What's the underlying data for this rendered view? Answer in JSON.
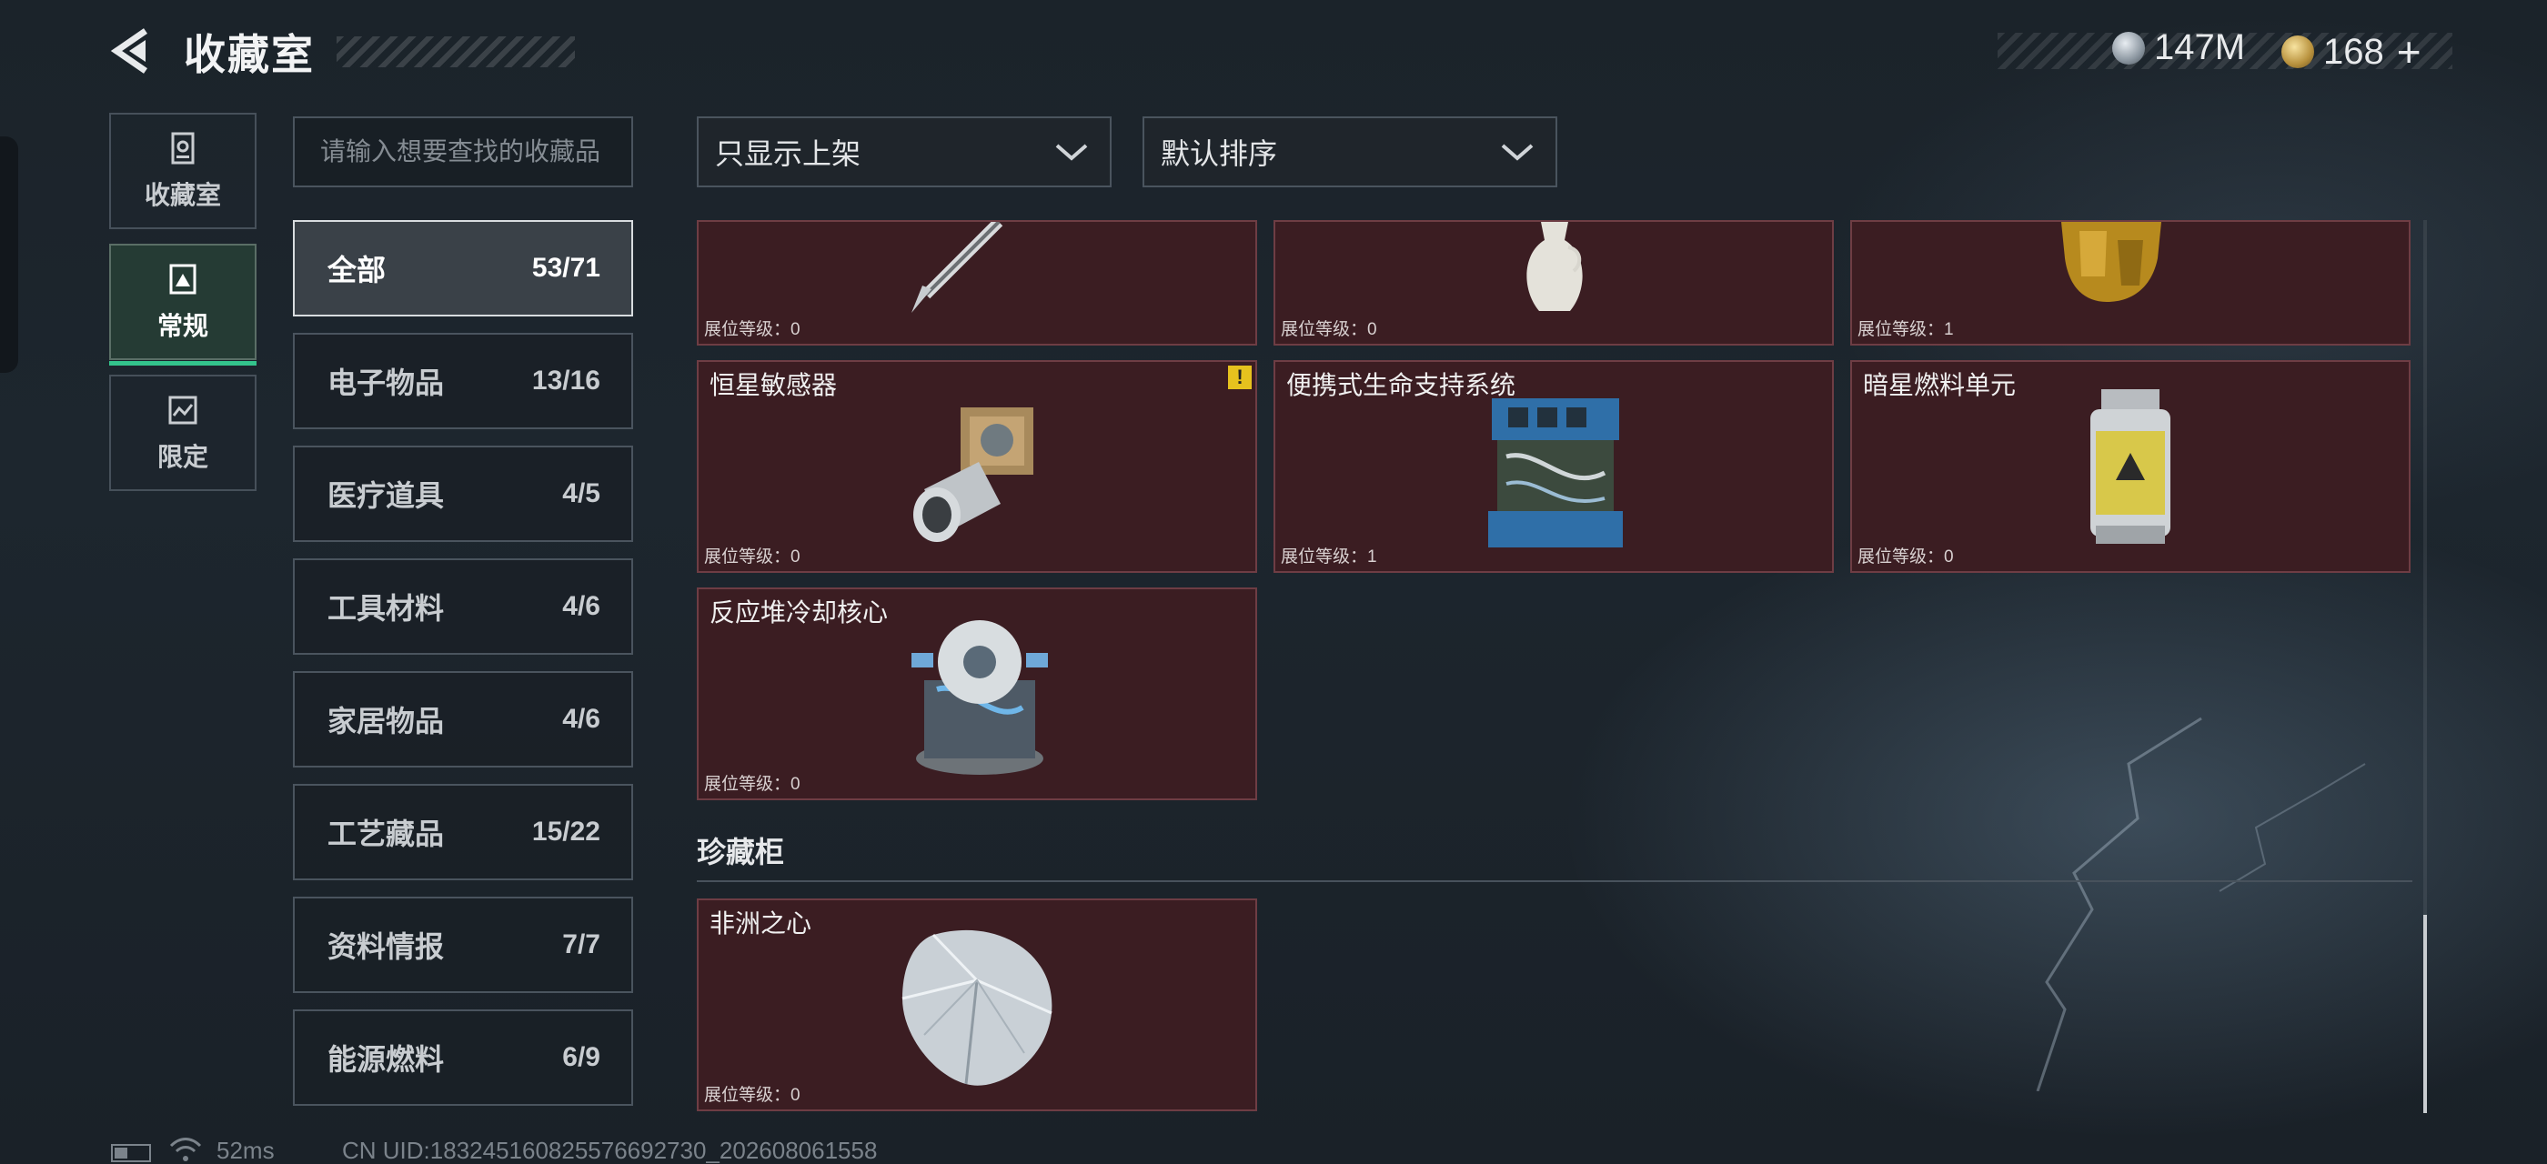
{
  "header": {
    "title": "收藏室",
    "currencies": [
      {
        "icon": "silver-coin-icon",
        "value": "147M"
      },
      {
        "icon": "gold-coin-icon",
        "value": "168"
      }
    ],
    "add_label": "+"
  },
  "modes": [
    {
      "label": "收藏室",
      "icon": "vault-icon",
      "active": false
    },
    {
      "label": "常规",
      "icon": "frame-icon",
      "active": true
    },
    {
      "label": "限定",
      "icon": "limited-icon",
      "active": false
    }
  ],
  "search": {
    "placeholder": "请输入想要查找的收藏品",
    "value": ""
  },
  "filters": {
    "display": {
      "selected": "只显示上架"
    },
    "sort": {
      "selected": "默认排序"
    }
  },
  "categories": [
    {
      "label": "全部",
      "count": "53/71",
      "active": true
    },
    {
      "label": "电子物品",
      "count": "13/16"
    },
    {
      "label": "医疗道具",
      "count": "4/5"
    },
    {
      "label": "工具材料",
      "count": "4/6"
    },
    {
      "label": "家居物品",
      "count": "4/6"
    },
    {
      "label": "工艺藏品",
      "count": "15/22"
    },
    {
      "label": "资料情报",
      "count": "7/7"
    },
    {
      "label": "能源燃料",
      "count": "6/9"
    }
  ],
  "items": [
    {
      "name": "",
      "level": "展位等级：0",
      "art": "pen-icon"
    },
    {
      "name": "",
      "level": "展位等级：0",
      "art": "vase-icon"
    },
    {
      "name": "",
      "level": "展位等级：1",
      "art": "gold-statue-icon"
    },
    {
      "name": "恒星敏感器",
      "level": "展位等级：0",
      "art": "star-sensor-icon",
      "warning": "!"
    },
    {
      "name": "便携式生命支持系统",
      "level": "展位等级：1",
      "art": "life-support-icon"
    },
    {
      "name": "暗星燃料单元",
      "level": "展位等级：0",
      "art": "fuel-cell-icon"
    },
    {
      "name": "反应堆冷却核心",
      "level": "展位等级：0",
      "art": "reactor-core-icon"
    }
  ],
  "cabinet": {
    "title": "珍藏柜",
    "items": [
      {
        "name": "非洲之心",
        "level": "展位等级：0",
        "art": "diamond-icon"
      }
    ]
  },
  "footer": {
    "ping": "52ms",
    "uid": "CN UID:18324516082557669273​0_202608061558"
  }
}
